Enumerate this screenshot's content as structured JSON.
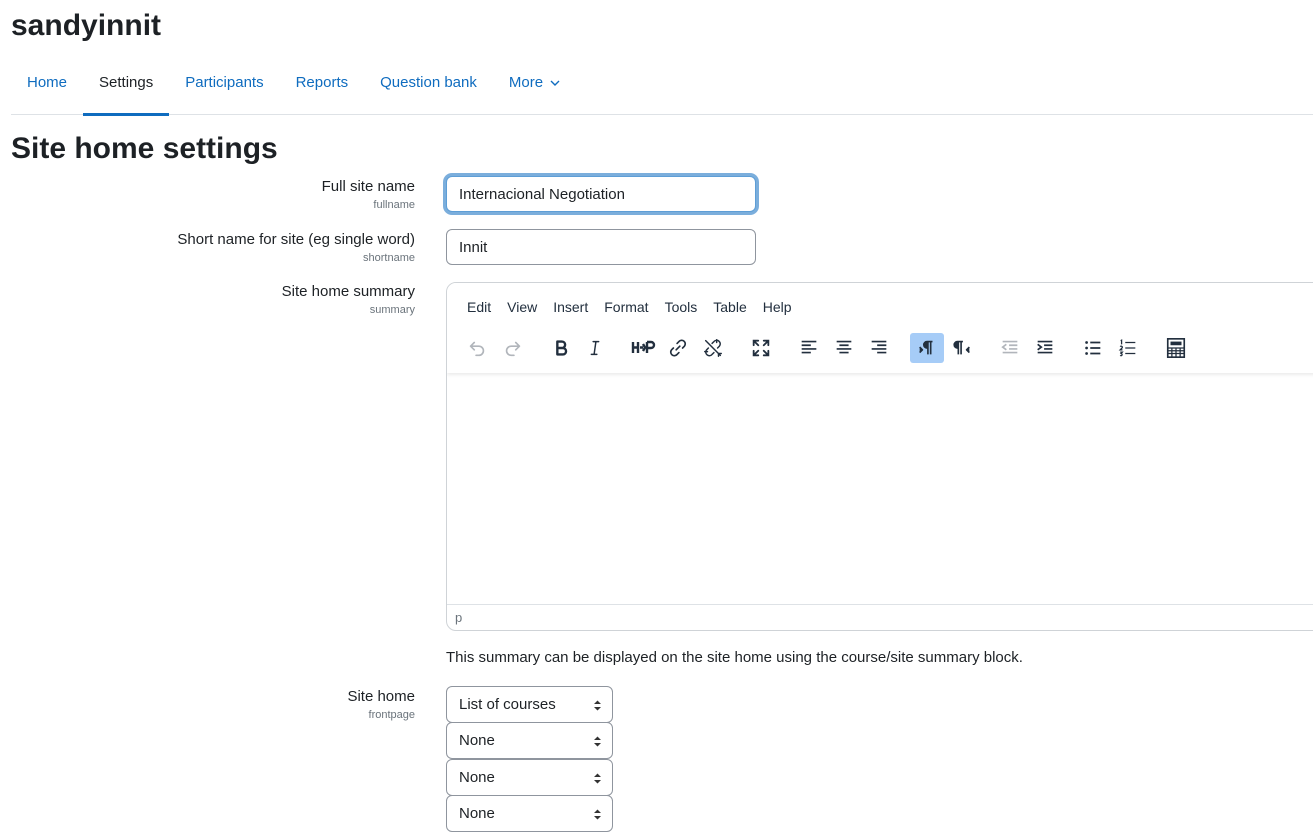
{
  "site": {
    "title": "sandyinnit"
  },
  "nav": {
    "items": [
      {
        "label": "Home"
      },
      {
        "label": "Settings"
      },
      {
        "label": "Participants"
      },
      {
        "label": "Reports"
      },
      {
        "label": "Question bank"
      },
      {
        "label": "More"
      }
    ],
    "active": "Settings"
  },
  "page": {
    "heading": "Site home settings"
  },
  "form": {
    "fullname": {
      "label": "Full site name",
      "sublabel": "fullname",
      "value": "Internacional Negotiation"
    },
    "shortname": {
      "label": "Short name for site (eg single word)",
      "sublabel": "shortname",
      "value": "Innit"
    },
    "summary": {
      "label": "Site home summary",
      "sublabel": "summary",
      "menu": [
        "Edit",
        "View",
        "Insert",
        "Format",
        "Tools",
        "Table",
        "Help"
      ],
      "status_path": "p",
      "help": "This summary can be displayed on the site home using the course/site summary block."
    },
    "frontpage": {
      "label": "Site home",
      "sublabel": "frontpage",
      "selects": [
        "List of courses",
        "None",
        "None",
        "None"
      ]
    }
  },
  "colors": {
    "link": "#0f6cbf",
    "focus": "#5e9ed6",
    "active_button": "#a6ccf7"
  },
  "icons": [
    "undo-icon",
    "redo-icon",
    "bold-icon",
    "italic-icon",
    "h5p-icon",
    "link-icon",
    "unlink-icon",
    "fullscreen-icon",
    "align-left-icon",
    "align-center-icon",
    "align-right-icon",
    "ltr-icon",
    "rtl-icon",
    "outdent-icon",
    "indent-icon",
    "bullet-list-icon",
    "numbered-list-icon",
    "equation-editor-icon"
  ]
}
